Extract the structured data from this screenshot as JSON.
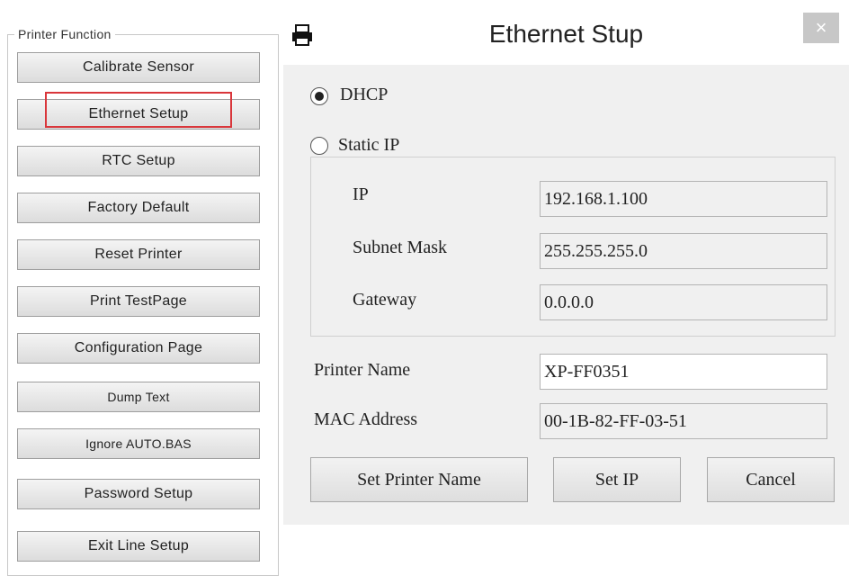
{
  "printer_function": {
    "title": "Printer Function",
    "buttons": [
      {
        "label": "Calibrate Sensor"
      },
      {
        "label": "Ethernet Setup"
      },
      {
        "label": "RTC Setup"
      },
      {
        "label": "Factory Default"
      },
      {
        "label": "Reset Printer"
      },
      {
        "label": "Print TestPage"
      },
      {
        "label": "Configuration Page"
      },
      {
        "label": "Dump Text"
      },
      {
        "label": "Ignore AUTO.BAS"
      },
      {
        "label": "Password Setup"
      },
      {
        "label": "Exit Line Setup"
      }
    ],
    "highlight_color": "#d9363b"
  },
  "dialog": {
    "title": "Ethernet Stup",
    "icon": "printer-icon",
    "close_label": "×",
    "dhcp_label": "DHCP",
    "dhcp_selected": true,
    "static_label": "Static IP",
    "ip_label": "IP",
    "ip_value": "192.168.1.100",
    "subnet_label": "Subnet Mask",
    "subnet_value": "255.255.255.0",
    "gateway_label": "Gateway",
    "gateway_value": "0.0.0.0",
    "printer_name_label": "Printer Name",
    "printer_name_value": "XP-FF0351",
    "mac_label": "MAC Address",
    "mac_value": "00-1B-82-FF-03-51",
    "set_printer_name_label": "Set Printer Name",
    "set_ip_label": "Set IP",
    "cancel_label": "Cancel"
  }
}
